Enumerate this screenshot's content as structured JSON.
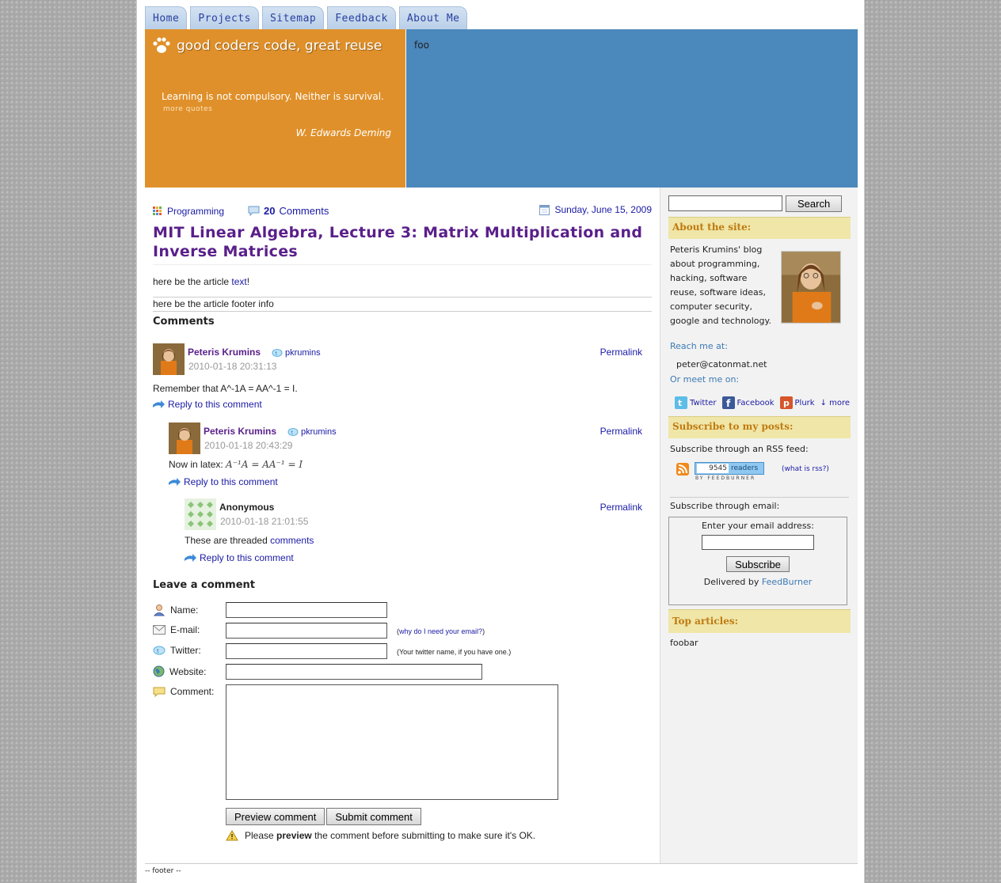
{
  "nav": {
    "tabs": [
      "Home",
      "Projects",
      "Sitemap",
      "Feedback",
      "About Me"
    ]
  },
  "header": {
    "logo_text": "good coders code, great reuse",
    "quote": "Learning is not compulsory. Neither is survival.",
    "more_quotes": "more quotes",
    "quote_author": "W. Edwards Deming",
    "banner_text": "foo"
  },
  "article": {
    "category": "Programming",
    "comments_count": "20",
    "comments_label": "Comments",
    "date": "Sunday, June 15, 2009",
    "title": "MIT Linear Algebra, Lecture 3: Matrix Multiplication and Inverse Matrices",
    "body_prefix": "here be the article ",
    "body_link": "text",
    "body_suffix": "!",
    "footer_info": "here be the article footer info"
  },
  "comments_section": {
    "heading": "Comments",
    "permalink_label": "Permalink",
    "reply_label": "Reply to this comment",
    "items": [
      {
        "name": "Peteris Krumins",
        "twitter": "pkrumins",
        "date": "2010-01-18 20:31:13",
        "text": "Remember that A^-1A = AA^-1 = I."
      },
      {
        "name": "Peteris Krumins",
        "twitter": "pkrumins",
        "date": "2010-01-18 20:43:29",
        "text_prefix": "Now in latex: ",
        "math": "A⁻¹A = AA⁻¹ = I"
      },
      {
        "name": "Anonymous",
        "date": "2010-01-18 21:01:55",
        "text_prefix": "These are threaded ",
        "text_link": "comments"
      }
    ]
  },
  "comment_form": {
    "heading": "Leave a comment",
    "name_label": "Name:",
    "email_label": "E-mail:",
    "email_note": "why do I need your email?",
    "twitter_label": "Twitter:",
    "twitter_note": "(Your twitter name, if you have one.)",
    "website_label": "Website:",
    "comment_label": "Comment:",
    "preview_button": "Preview comment",
    "submit_button": "Submit comment",
    "warning_prefix": "Please ",
    "warning_bold": "preview",
    "warning_suffix": " the comment before submitting to make sure it's OK."
  },
  "sidebar": {
    "search_button": "Search",
    "about_heading": "About the site:",
    "about_lines": [
      "Peteris Krumins' blog",
      "about programming,",
      "hacking, software",
      "reuse, software ideas,",
      "computer security,",
      "google and technology."
    ],
    "reach_label": "Reach me at:",
    "email": "peter@catonmat.net",
    "meet_label": "Or meet me on:",
    "social": [
      "Twitter",
      "Facebook",
      "Plurk"
    ],
    "more_label": "↓ more",
    "subscribe_heading": "Subscribe to my posts:",
    "rss_label": "Subscribe through an RSS feed:",
    "readers_count": "9545",
    "readers_label": "readers",
    "feedburner_by": "BY FEEDBURNER",
    "what_is_rss": "(what is rss?)",
    "email_sub_label": "Subscribe through email:",
    "enter_email": "Enter your email address:",
    "subscribe_button": "Subscribe",
    "delivered_by": "Delivered by ",
    "feedburner": "FeedBurner",
    "top_heading": "Top articles:",
    "top_item": "foobar"
  },
  "footer": {
    "text": "-- footer --"
  },
  "colors": {
    "header_orange": "#e0902a",
    "header_blue": "#4b88bb",
    "title_purple": "#5a1f8a",
    "link_blue": "#1a1aa6",
    "sidebar_head_bg": "#efe6a8",
    "sidebar_head_text": "#c07a10"
  }
}
